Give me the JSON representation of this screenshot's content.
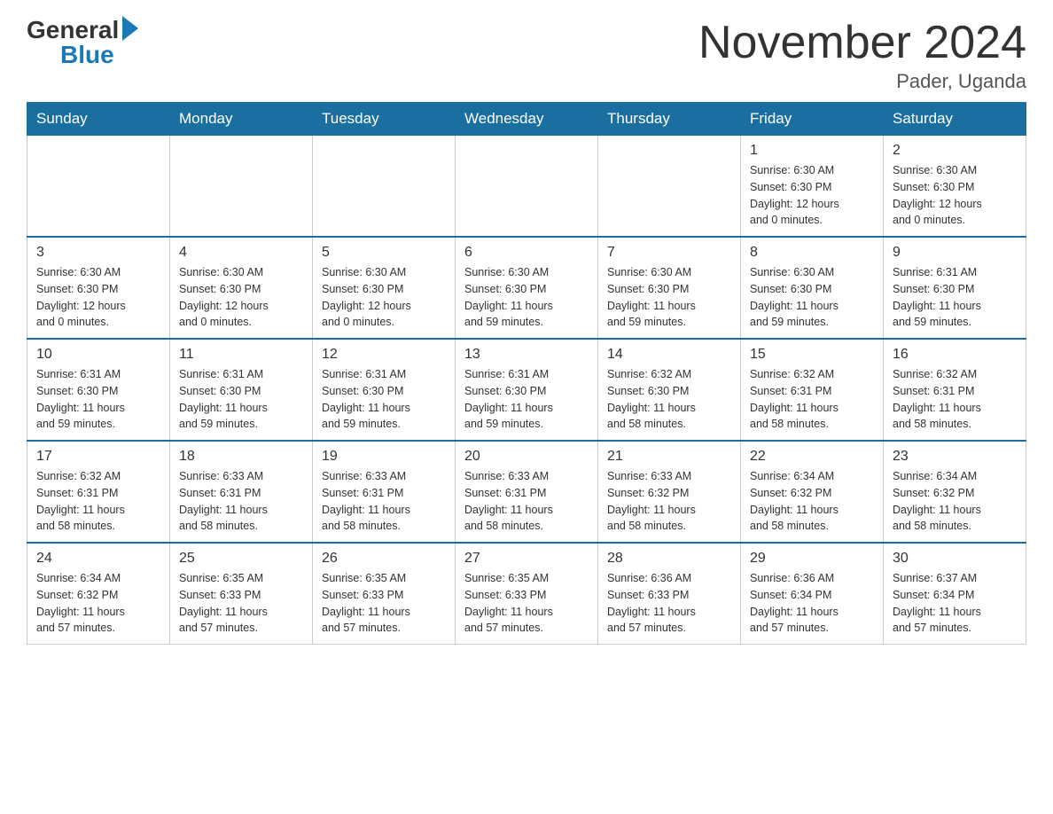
{
  "header": {
    "title": "November 2024",
    "location": "Pader, Uganda",
    "logo_general": "General",
    "logo_blue": "Blue"
  },
  "days_of_week": [
    "Sunday",
    "Monday",
    "Tuesday",
    "Wednesday",
    "Thursday",
    "Friday",
    "Saturday"
  ],
  "weeks": [
    {
      "days": [
        {
          "num": "",
          "info": ""
        },
        {
          "num": "",
          "info": ""
        },
        {
          "num": "",
          "info": ""
        },
        {
          "num": "",
          "info": ""
        },
        {
          "num": "",
          "info": ""
        },
        {
          "num": "1",
          "info": "Sunrise: 6:30 AM\nSunset: 6:30 PM\nDaylight: 12 hours\nand 0 minutes."
        },
        {
          "num": "2",
          "info": "Sunrise: 6:30 AM\nSunset: 6:30 PM\nDaylight: 12 hours\nand 0 minutes."
        }
      ]
    },
    {
      "days": [
        {
          "num": "3",
          "info": "Sunrise: 6:30 AM\nSunset: 6:30 PM\nDaylight: 12 hours\nand 0 minutes."
        },
        {
          "num": "4",
          "info": "Sunrise: 6:30 AM\nSunset: 6:30 PM\nDaylight: 12 hours\nand 0 minutes."
        },
        {
          "num": "5",
          "info": "Sunrise: 6:30 AM\nSunset: 6:30 PM\nDaylight: 12 hours\nand 0 minutes."
        },
        {
          "num": "6",
          "info": "Sunrise: 6:30 AM\nSunset: 6:30 PM\nDaylight: 11 hours\nand 59 minutes."
        },
        {
          "num": "7",
          "info": "Sunrise: 6:30 AM\nSunset: 6:30 PM\nDaylight: 11 hours\nand 59 minutes."
        },
        {
          "num": "8",
          "info": "Sunrise: 6:30 AM\nSunset: 6:30 PM\nDaylight: 11 hours\nand 59 minutes."
        },
        {
          "num": "9",
          "info": "Sunrise: 6:31 AM\nSunset: 6:30 PM\nDaylight: 11 hours\nand 59 minutes."
        }
      ]
    },
    {
      "days": [
        {
          "num": "10",
          "info": "Sunrise: 6:31 AM\nSunset: 6:30 PM\nDaylight: 11 hours\nand 59 minutes."
        },
        {
          "num": "11",
          "info": "Sunrise: 6:31 AM\nSunset: 6:30 PM\nDaylight: 11 hours\nand 59 minutes."
        },
        {
          "num": "12",
          "info": "Sunrise: 6:31 AM\nSunset: 6:30 PM\nDaylight: 11 hours\nand 59 minutes."
        },
        {
          "num": "13",
          "info": "Sunrise: 6:31 AM\nSunset: 6:30 PM\nDaylight: 11 hours\nand 59 minutes."
        },
        {
          "num": "14",
          "info": "Sunrise: 6:32 AM\nSunset: 6:30 PM\nDaylight: 11 hours\nand 58 minutes."
        },
        {
          "num": "15",
          "info": "Sunrise: 6:32 AM\nSunset: 6:31 PM\nDaylight: 11 hours\nand 58 minutes."
        },
        {
          "num": "16",
          "info": "Sunrise: 6:32 AM\nSunset: 6:31 PM\nDaylight: 11 hours\nand 58 minutes."
        }
      ]
    },
    {
      "days": [
        {
          "num": "17",
          "info": "Sunrise: 6:32 AM\nSunset: 6:31 PM\nDaylight: 11 hours\nand 58 minutes."
        },
        {
          "num": "18",
          "info": "Sunrise: 6:33 AM\nSunset: 6:31 PM\nDaylight: 11 hours\nand 58 minutes."
        },
        {
          "num": "19",
          "info": "Sunrise: 6:33 AM\nSunset: 6:31 PM\nDaylight: 11 hours\nand 58 minutes."
        },
        {
          "num": "20",
          "info": "Sunrise: 6:33 AM\nSunset: 6:31 PM\nDaylight: 11 hours\nand 58 minutes."
        },
        {
          "num": "21",
          "info": "Sunrise: 6:33 AM\nSunset: 6:32 PM\nDaylight: 11 hours\nand 58 minutes."
        },
        {
          "num": "22",
          "info": "Sunrise: 6:34 AM\nSunset: 6:32 PM\nDaylight: 11 hours\nand 58 minutes."
        },
        {
          "num": "23",
          "info": "Sunrise: 6:34 AM\nSunset: 6:32 PM\nDaylight: 11 hours\nand 58 minutes."
        }
      ]
    },
    {
      "days": [
        {
          "num": "24",
          "info": "Sunrise: 6:34 AM\nSunset: 6:32 PM\nDaylight: 11 hours\nand 57 minutes."
        },
        {
          "num": "25",
          "info": "Sunrise: 6:35 AM\nSunset: 6:33 PM\nDaylight: 11 hours\nand 57 minutes."
        },
        {
          "num": "26",
          "info": "Sunrise: 6:35 AM\nSunset: 6:33 PM\nDaylight: 11 hours\nand 57 minutes."
        },
        {
          "num": "27",
          "info": "Sunrise: 6:35 AM\nSunset: 6:33 PM\nDaylight: 11 hours\nand 57 minutes."
        },
        {
          "num": "28",
          "info": "Sunrise: 6:36 AM\nSunset: 6:33 PM\nDaylight: 11 hours\nand 57 minutes."
        },
        {
          "num": "29",
          "info": "Sunrise: 6:36 AM\nSunset: 6:34 PM\nDaylight: 11 hours\nand 57 minutes."
        },
        {
          "num": "30",
          "info": "Sunrise: 6:37 AM\nSunset: 6:34 PM\nDaylight: 11 hours\nand 57 minutes."
        }
      ]
    }
  ]
}
